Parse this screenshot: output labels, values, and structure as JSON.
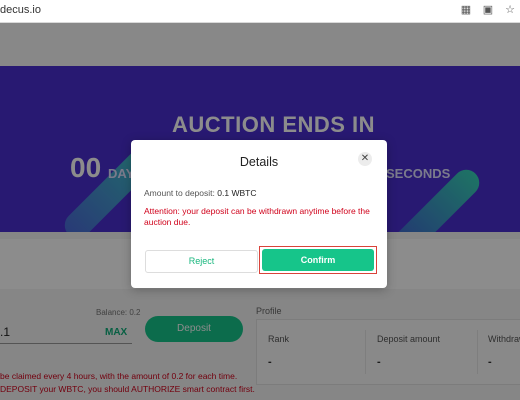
{
  "browser": {
    "url": "decus.io",
    "icons": [
      "qr-code-icon",
      "translate-icon",
      "star-icon"
    ]
  },
  "hero": {
    "title": "AUCTION ENDS IN",
    "days_value": "00",
    "days_label": "DAY",
    "seconds_label": "SECONDS"
  },
  "deposit_panel": {
    "balance_label": "Balance: 0.2",
    "amount_value": ".1",
    "max_label": "MAX",
    "deposit_label": "Deposit"
  },
  "profile": {
    "title": "Profile",
    "columns": [
      {
        "label": "Rank",
        "value": "-"
      },
      {
        "label": "Deposit amount",
        "value": "-"
      },
      {
        "label": "Withdraw",
        "value": "-"
      }
    ]
  },
  "notes": [
    "be claimed every 4 hours, with the amount of 0.2 for each time.",
    "DEPOSIT your WBTC, you should AUTHORIZE smart contract first."
  ],
  "modal": {
    "title": "Details",
    "amount_label": "Amount to deposit:",
    "amount_value": "0.1 WBTC",
    "attention": "Attention: your deposit can be withdrawn anytime before the auction due.",
    "reject_label": "Reject",
    "confirm_label": "Confirm",
    "close_icon": "close-icon"
  },
  "colors": {
    "hero_bg": "#4a2fd0",
    "accent_green": "#16c58a",
    "alert_red": "#d0021b",
    "highlight_frame": "#d9433a"
  }
}
